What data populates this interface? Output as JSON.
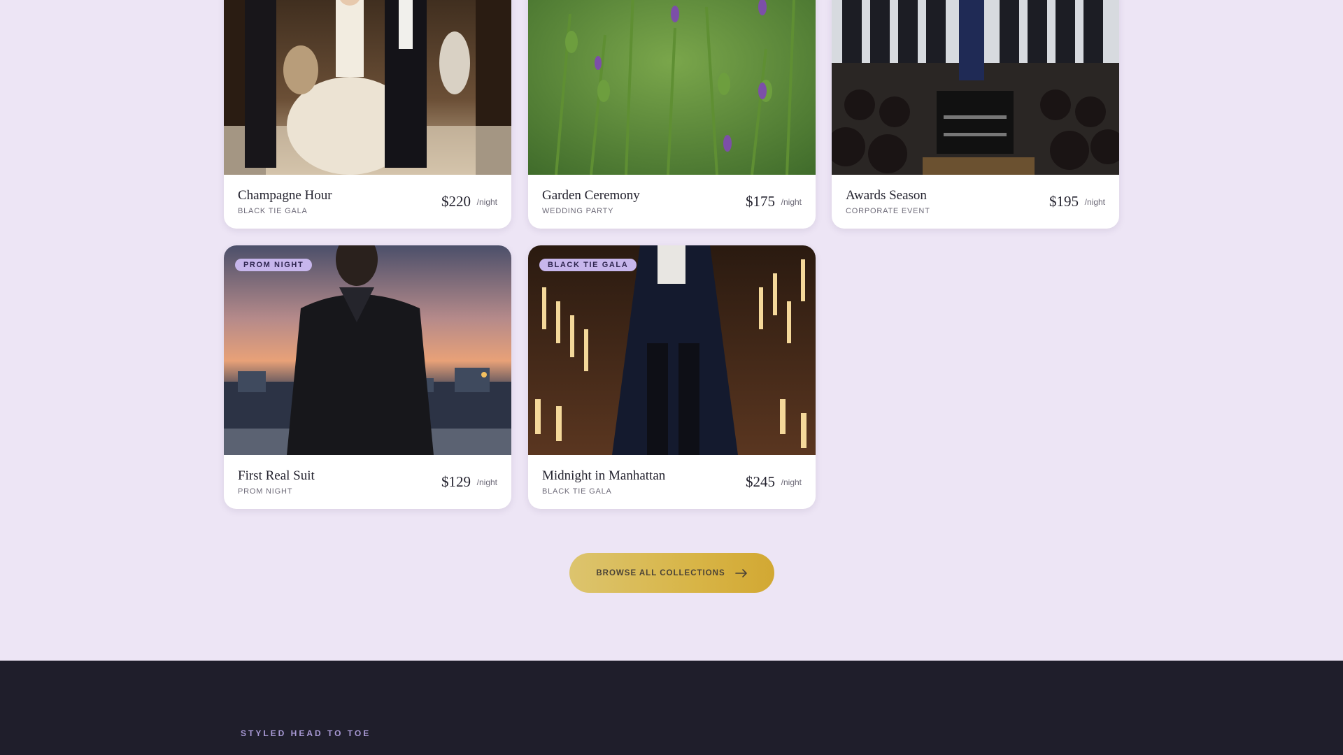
{
  "cards": [
    {
      "name": "Champagne Hour",
      "category": "BLACK TIE GALA",
      "price": "$220",
      "unit": "/night"
    },
    {
      "name": "Garden Ceremony",
      "category": "WEDDING PARTY",
      "price": "$175",
      "unit": "/night"
    },
    {
      "name": "Awards Season",
      "category": "CORPORATE EVENT",
      "price": "$195",
      "unit": "/night"
    },
    {
      "name": "First Real Suit",
      "category": "PROM NIGHT",
      "price": "$129",
      "unit": "/night",
      "badge": "PROM NIGHT"
    },
    {
      "name": "Midnight in Manhattan",
      "category": "BLACK TIE GALA",
      "price": "$245",
      "unit": "/night",
      "badge": "BLACK TIE GALA"
    }
  ],
  "cta": {
    "label": "BROWSE ALL COLLECTIONS",
    "icon": "arrow-right-icon"
  },
  "footer": {
    "tagline": "STYLED HEAD TO TOE"
  },
  "colors": {
    "background": "#ede5f5",
    "accent_gold": "#d8b547",
    "badge": "#c7b6ec",
    "footer": "#1f1e2b"
  }
}
